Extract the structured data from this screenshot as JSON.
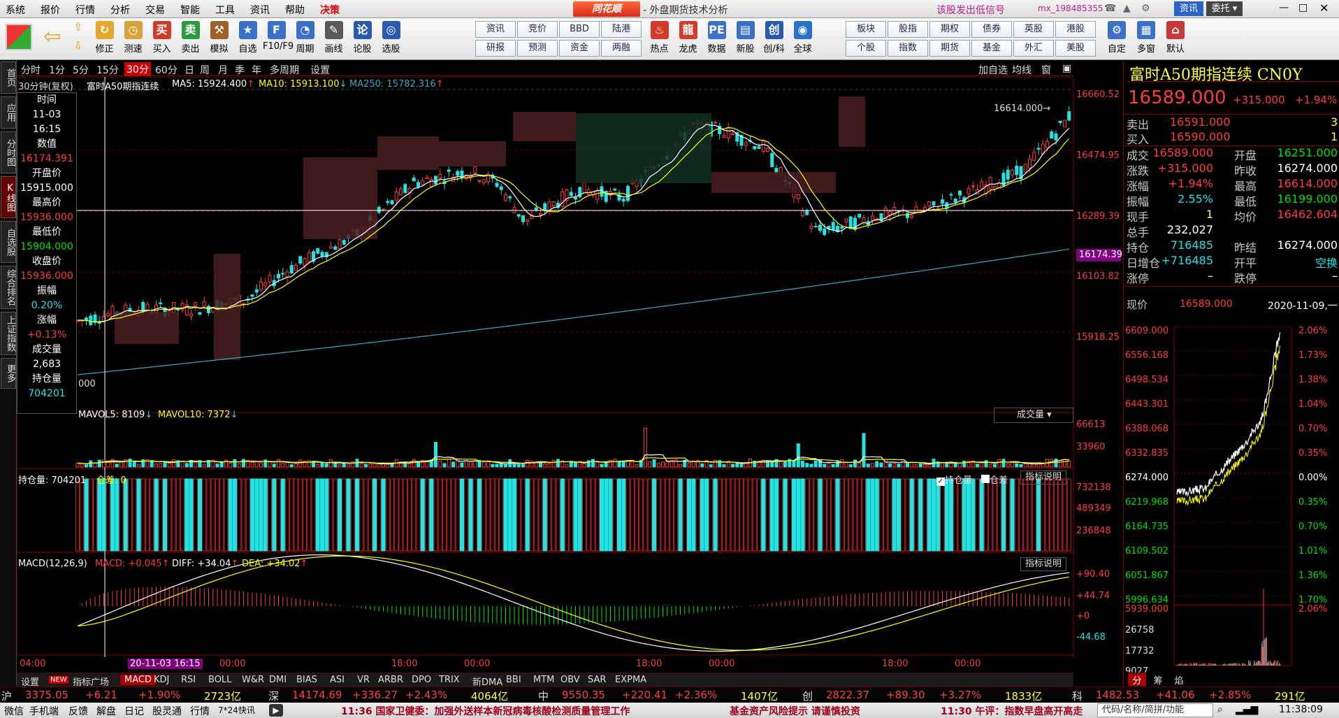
{
  "menu": {
    "items": [
      "系统",
      "报价",
      "行情",
      "分析",
      "交易",
      "智能",
      "工具",
      "资讯",
      "帮助",
      "决策"
    ],
    "brand": "同花顺",
    "title": "- 外盘期货技术分析",
    "promo": "该股发出低信号",
    "user": "mx_198485355",
    "btn_news": "资讯",
    "btn_trust": "委托"
  },
  "toolbar": {
    "tools": [
      {
        "label": "修正",
        "icon": "refresh-icon",
        "color": "#e7a72b"
      },
      {
        "label": "测速",
        "icon": "stopwatch-icon",
        "color": "#d8a43a"
      },
      {
        "label": "买入",
        "icon": "buy-icon",
        "color": "#d43a2a"
      },
      {
        "label": "卖出",
        "icon": "sell-icon",
        "color": "#2a9a3a"
      },
      {
        "label": "模拟",
        "icon": "hammer-icon",
        "color": "#a0602a"
      },
      {
        "label": "自选",
        "icon": "star-icon",
        "color": "#3a70c8"
      },
      {
        "label": "F10/F9",
        "icon": "f10-icon",
        "color": "#3a70c8"
      },
      {
        "label": "周期",
        "icon": "period-icon",
        "color": "#3a70c8"
      },
      {
        "label": "画线",
        "icon": "pen-icon",
        "color": "#5a5a5a"
      },
      {
        "label": "论股",
        "icon": "forum-icon",
        "color": "#2a5ab0"
      },
      {
        "label": "选股",
        "icon": "select-icon",
        "color": "#2a5ab0"
      }
    ],
    "btn_grid": [
      [
        "资讯",
        "竞价",
        "BBD",
        "陆港"
      ],
      [
        "研报",
        "预测",
        "资金",
        "两融"
      ]
    ],
    "tools2": [
      {
        "label": "热点",
        "icon": "hot-icon",
        "color": "#d43a2a"
      },
      {
        "label": "龙虎",
        "icon": "dragon-icon",
        "color": "#d43a2a"
      },
      {
        "label": "数据",
        "icon": "data-icon",
        "color": "#3a70c8"
      },
      {
        "label": "新股",
        "icon": "newstock-icon",
        "color": "#3a70c8"
      },
      {
        "label": "创/科",
        "icon": "chuang-icon",
        "color": "#2a5ab0"
      },
      {
        "label": "全球",
        "icon": "globe-icon",
        "color": "#2a70c8"
      }
    ],
    "btn_grid2": [
      [
        "板块",
        "股指",
        "期权",
        "债券",
        "英股",
        "港股"
      ],
      [
        "个股",
        "指数",
        "期货",
        "基金",
        "外汇",
        "美股"
      ]
    ],
    "tools3": [
      {
        "label": "自定",
        "icon": "custom-icon",
        "color": "#3a70c8"
      },
      {
        "label": "多窗",
        "icon": "multiwin-icon",
        "color": "#3a70c8"
      },
      {
        "label": "默认",
        "icon": "home-icon",
        "color": "#c83a3a"
      }
    ]
  },
  "leftbar": {
    "tabs": [
      "首页",
      "应用",
      "分时图",
      "K线图",
      "自选股",
      "综合排名",
      "上证指数",
      "更多"
    ]
  },
  "periods": {
    "items": [
      "分时",
      "1分",
      "5分",
      "15分",
      "30分",
      "60分",
      "日",
      "周",
      "月",
      "季",
      "年",
      "多周期",
      "设置"
    ],
    "active": "30分",
    "right": [
      "加自选",
      "均线",
      "窗"
    ]
  },
  "chart_header": {
    "label": "30分钟(复权)",
    "name": "富时A50期指连续",
    "ma5": "MA5: 15924.400",
    "ma10": "MA10: 15913.100",
    "ma250": "MA250: 15782.316",
    "peak_label": "16614.000",
    "cursor_price": "16174.39",
    "price_ticks": [
      "16660.52",
      "16474.95",
      "16289.39",
      "16103.82",
      "15918.25"
    ]
  },
  "info": {
    "time_label": "时间",
    "date": "11-03",
    "time": "16:15",
    "value_label": "数值",
    "value": "16174.391",
    "open_label": "开盘价",
    "open": "15915.000",
    "high_label": "最高价",
    "high": "15936.000",
    "low_label": "最低价",
    "low": "15904.000",
    "close_label": "收盘价",
    "close": "15936.000",
    "amp_label": "振幅",
    "amp": "0.20%",
    "chg_label": "涨幅",
    "chg": "+0.13%",
    "vol_label": "成交量",
    "vol": "2,683",
    "oi_label": "持仓量",
    "oi": "704201",
    "left_tick": "000"
  },
  "volume": {
    "header_l5": "MAVOL5: 8109",
    "header_l10": "MAVOL10: 7372",
    "dropdown": "成交量",
    "ticks": [
      "66613",
      "33960"
    ]
  },
  "oi_panel": {
    "header": "持仓量: 704201",
    "diff": "仓差: 0",
    "chk1": "持仓量",
    "chk2": "仓差",
    "explain": "指标说明",
    "ticks": [
      "732138",
      "489349",
      "236848"
    ]
  },
  "macd": {
    "header": "MACD(12,26,9)",
    "macd": "MACD: +0.045",
    "diff": "DIFF: +34.04",
    "dea": "DEA: +34.02",
    "explain": "指标说明",
    "ticks": [
      "+90.40",
      "+44.74",
      "+0",
      "-44.68"
    ]
  },
  "time_axis": {
    "labels": [
      "04:00",
      "20-11-03 16:15",
      "00:00",
      "18:00",
      "00:00",
      "18:00",
      "00:00",
      "18:00",
      "00:00"
    ]
  },
  "bottom_tabs": {
    "items": [
      "设置",
      "指标广场",
      "MACD",
      "KDJ",
      "RSI",
      "BOLL",
      "W&R",
      "DMI",
      "BIAS",
      "ASI",
      "VR",
      "ARBR",
      "DPO",
      "TRIX",
      "新DMA",
      "BBI",
      "MTM",
      "OBV",
      "SAR",
      "EXPMA"
    ],
    "new_badge": "NEW"
  },
  "quote": {
    "name": "富时A50期指连续",
    "code": "CN0Y",
    "price": "16589.000",
    "change": "+315.000",
    "pct": "+1.94%",
    "sell_label": "卖出",
    "sell": "16591.000",
    "sell_vol": "3",
    "buy_label": "买入",
    "buy": "16590.000",
    "buy_vol": "1",
    "rows": [
      {
        "l1": "成交",
        "v1": "16589.000",
        "l2": "开盘",
        "v2": "16251.000"
      },
      {
        "l1": "涨跌",
        "v1": "+315.000",
        "l2": "昨收",
        "v2": "16274.000"
      },
      {
        "l1": "涨幅",
        "v1": "+1.94%",
        "l2": "最高",
        "v2": "16614.000"
      },
      {
        "l1": "振幅",
        "v1": "2.55%",
        "l2": "最低",
        "v2": "16199.000"
      },
      {
        "l1": "现手",
        "v1": "1",
        "l2": "均价",
        "v2": "16462.604"
      },
      {
        "l1": "总手",
        "v1": "232,027",
        "l2": "",
        "v2": ""
      },
      {
        "l1": "持仓",
        "v1": "716485",
        "l2": "昨结",
        "v2": "16274.000"
      },
      {
        "l1": "日增仓",
        "v1": "+716485",
        "l2": "开平",
        "v2": "空换"
      },
      {
        "l1": "涨停",
        "v1": "–",
        "l2": "跌停",
        "v2": "–"
      }
    ],
    "now_label": "现价",
    "now": "16589.000",
    "date": "2020-11-09,一",
    "mini_ticks_l": [
      "6609.000",
      "6556.168",
      "6498.534",
      "6443.301",
      "6388.068",
      "6332.835",
      "6274.000",
      "6219.968",
      "6164.735",
      "6109.502",
      "6051.867",
      "5996.634"
    ],
    "mini_ticks_r": [
      "2.06%",
      "1.73%",
      "1.38%",
      "1.04%",
      "0.70%",
      "0.35%",
      "0.00%",
      "0.35%",
      "0.70%",
      "1.01%",
      "1.36%",
      "1.70%"
    ],
    "mini_vol_ticks_l": [
      "5939.000",
      "26758",
      "17732",
      "9027"
    ],
    "mini_vol_ticks_r": [
      "2.06%"
    ],
    "tabs": [
      "分",
      "筹",
      "焰"
    ]
  },
  "index_bar": [
    {
      "name": "沪",
      "val": "3375.05",
      "chg": "+6.21",
      "pct": "+1.90%",
      "amt": "2723亿"
    },
    {
      "name": "深",
      "val": "14174.69",
      "chg": "+336.27",
      "pct": "+2.43%",
      "amt": "4064亿"
    },
    {
      "name": "中",
      "val": "9550.35",
      "chg": "+220.41",
      "pct": "+2.36%",
      "amt": "1407亿"
    },
    {
      "name": "创",
      "val": "2822.37",
      "chg": "+89.30",
      "pct": "+3.27%",
      "amt": "1833亿"
    },
    {
      "name": "科",
      "val": "1482.53",
      "chg": "+41.06",
      "pct": "+2.85%",
      "amt": "291亿"
    }
  ],
  "status_bar": {
    "items": [
      "微信",
      "手机端",
      "反馈",
      "解盘",
      "日记",
      "股灵通",
      "行情",
      "7*24快讯"
    ],
    "news1": "11:36 国家卫健委：加强外送样本新冠病毒核酸检测质量管理工作",
    "news2": "基金资产风险提示 请谨慎投资",
    "news3": "11:30 午评：指数早盘高开高走",
    "search": "代码/名称/简拼/功能",
    "clock": "11:38:09"
  },
  "colors": {
    "up": "#ff3c3c",
    "down": "#22e2e2",
    "ma5": "#ffffff",
    "ma10": "#ffff00",
    "ma250": "#33aacc"
  }
}
